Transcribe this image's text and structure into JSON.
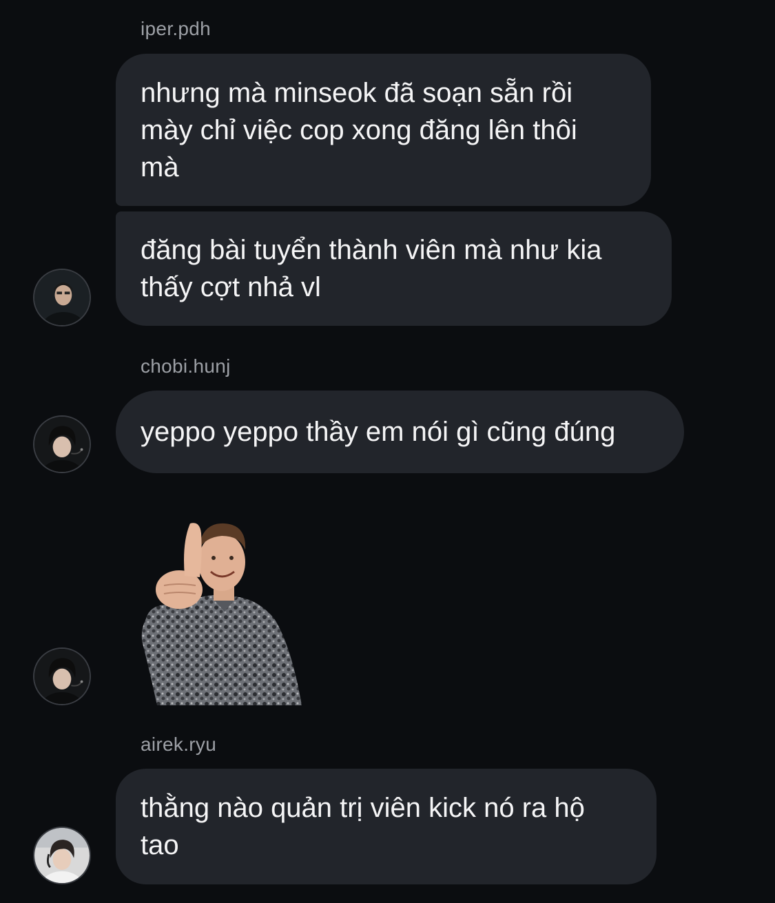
{
  "messages": [
    {
      "sender": "iper.pdh",
      "bubbles": [
        {
          "lines": [
            "nhưng mà minseok đã soạn sẵn rồi",
            "mày chỉ việc cop xong đăng lên thôi",
            "mà"
          ]
        },
        {
          "lines": [
            "đăng bài tuyển thành viên mà như kia",
            "thấy cợt nhả vl"
          ]
        }
      ],
      "avatar": "avatar-iper"
    },
    {
      "sender": "chobi.hunj",
      "bubbles": [
        {
          "lines": [
            "yeppo yeppo thầy em nói gì cũng đúng"
          ]
        }
      ],
      "avatar": "avatar-chobi",
      "sticker": "thumbs-up-man-sticker"
    },
    {
      "sender": "airek.ryu",
      "bubbles": [
        {
          "lines": [
            "thằng nào quản trị viên kick nó ra hộ",
            "tao"
          ]
        }
      ],
      "avatar": "avatar-airek"
    }
  ],
  "colors": {
    "background": "#0b0d10",
    "bubble": "#22252b",
    "sender_text": "#9da0a6"
  }
}
